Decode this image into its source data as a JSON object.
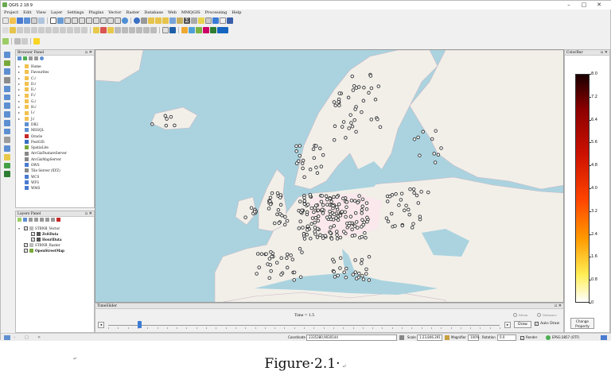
{
  "window": {
    "title": "QGIS 2.18.9"
  },
  "menu": [
    "Project",
    "Edit",
    "View",
    "Layer",
    "Settings",
    "Plugins",
    "Vector",
    "Raster",
    "Database",
    "Web",
    "MMQGIS",
    "Processing",
    "Help"
  ],
  "browser_panel": {
    "title": "Browser Panel",
    "items": [
      "Home",
      "Favourites",
      "C:/",
      "D:/",
      "E:/",
      "F:/",
      "G:/",
      "H:/",
      "I:/",
      "J:/",
      "DB2",
      "MSSQL",
      "Oracle",
      "PostGIS",
      "SpatiaLite",
      "ArcGisFeatureServer",
      "ArcGisMapServer",
      "OWS",
      "Tile Server (XYZ)",
      "WCS",
      "WFS",
      "WMS"
    ]
  },
  "layers_panel": {
    "title": "Layers Panel",
    "items": [
      {
        "label": "STBNB_Vector",
        "bold": false,
        "indent": 0
      },
      {
        "label": "ZeitData",
        "bold": true,
        "indent": 1
      },
      {
        "label": "HourlData",
        "bold": true,
        "indent": 1
      },
      {
        "label": "STBNB_Raster",
        "bold": false,
        "indent": 0
      },
      {
        "label": "OpenStreetMap",
        "bold": true,
        "indent": 0
      }
    ]
  },
  "colorbar": {
    "title": "ColorBar",
    "ticks": [
      "8.0",
      "7.2",
      "6.4",
      "5.6",
      "4.8",
      "4.0",
      "3.2",
      "2.4",
      "1.6",
      "0.8",
      "0"
    ]
  },
  "time_slider": {
    "title": "TimeSlider",
    "time_label": "Time = 1.5",
    "mean_label": "Mean",
    "variance_label": "Variance",
    "draw_label": "Draw",
    "auto_draw_label": "Auto Draw",
    "change_property_label": "Change Property",
    "slider_value": 0.08
  },
  "statusbar": {
    "coordinate_label": "Coordinate",
    "coordinate_value": "2335380,9030144",
    "scale_label": "Scale",
    "scale_value": "1:23,846,391",
    "magnifier_label": "Magnifier",
    "magnifier_value": "100%",
    "rotation_label": "Rotation",
    "rotation_value": "0.0",
    "render_label": "Render",
    "crs_label": "EPSG:3857 (OTF)"
  },
  "caption": "Figure·2.1·",
  "colors": {
    "sea": "#aad3df",
    "land": "#f2efe9",
    "highlight": "#fbe6ec"
  }
}
